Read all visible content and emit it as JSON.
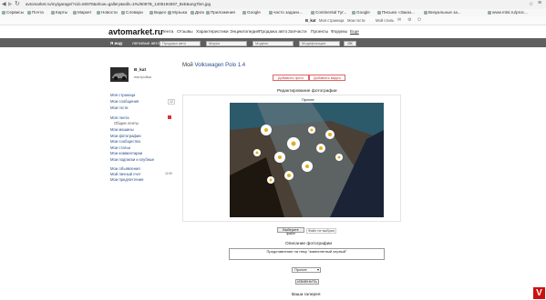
{
  "browser": {
    "url": "avtomarket.ru/my/garage/?cid=60978&show=gallery&edit=1#u/6097B_1405194597_8xE&ung7bm.jpg",
    "bookmarks": [
      "Сервисы",
      "Почта",
      "Карты",
      "Маркет",
      "Новости",
      "Словари",
      "Видео",
      "Музыка",
      "Диск",
      "Приложения",
      "Google",
      "часто заданн...",
      "Continental Tyr...",
      "Google",
      "Письмо «Заказ...",
      "Визуальные за...",
      "www.mtsi.ru/proc..."
    ]
  },
  "site": {
    "top_user": "B_kat",
    "top_links": [
      "Моя страница",
      "Мои гости",
      "Мой стиль"
    ],
    "logo": "avtomarket.ru",
    "nav": [
      "Лента",
      "Отзывы",
      "Характеристики",
      "Энциклопедия",
      "Продажа авто",
      "Запчасти",
      "Проекты",
      "Форумы",
      "Еще"
    ],
    "bar_label": "Я ищу",
    "bar_label2": "легковые авто",
    "selects": [
      "Продажа авто",
      "Марка",
      "Модель",
      "Модификация"
    ],
    "ok": "ОК"
  },
  "sidebar": {
    "username": "B_kat",
    "status": "настройки",
    "links": [
      "Моя страница",
      "Мои сообщения",
      "Мои гости",
      "",
      "Моя лента",
      "Общие ленты",
      "Мои машины",
      "Мои фотографии",
      "Мои сообщества",
      "Мои статьи",
      "Мои комментарии",
      "Мои подписки и клубные",
      "",
      "Мои объявления",
      "Мой личный счет",
      "Мои предпочтения"
    ],
    "counts": [
      "12",
      "",
      "0",
      "",
      "1199"
    ]
  },
  "main": {
    "title_prefix": "Мой",
    "title_car": "Volkswagen Polo 1.4",
    "add_photo": "Добавить фото",
    "add_video": "Добавить видео",
    "edit_heading": "Редактирование фотографии",
    "photo_caption": "Прочее",
    "choose_file": "Выберите файл",
    "no_file": "Файл не выбран",
    "desc_label": "Описание фотографии",
    "desc_value": "Представление на тему \"зимнелетный черный\"",
    "category": "Прочее",
    "save": "ИЗМЕНИТЬ",
    "gallery": "Ваша галерея"
  }
}
